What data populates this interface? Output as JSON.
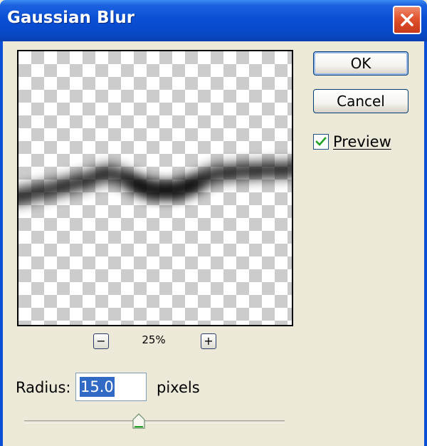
{
  "window": {
    "title": "Gaussian Blur"
  },
  "buttons": {
    "ok": "OK",
    "cancel": "Cancel"
  },
  "preview": {
    "checkbox_label": "Preview",
    "checked": true
  },
  "zoom": {
    "level": "25%",
    "zoom_out_symbol": "−",
    "zoom_in_symbol": "+"
  },
  "radius": {
    "label": "Radius:",
    "value": "15.0",
    "units": "pixels",
    "slider_fraction": 0.44
  },
  "icons": {
    "close": "close-icon",
    "check": "checkmark-icon",
    "zoom_out": "minus-icon",
    "zoom_in": "plus-icon",
    "slider_thumb": "slider-thumb-icon"
  },
  "colors": {
    "titlebar": "#0a4fd6",
    "close_button": "#e0522e",
    "selection": "#316ac5",
    "checkmark": "#21a121",
    "dialog_bg": "#ece9d8"
  }
}
